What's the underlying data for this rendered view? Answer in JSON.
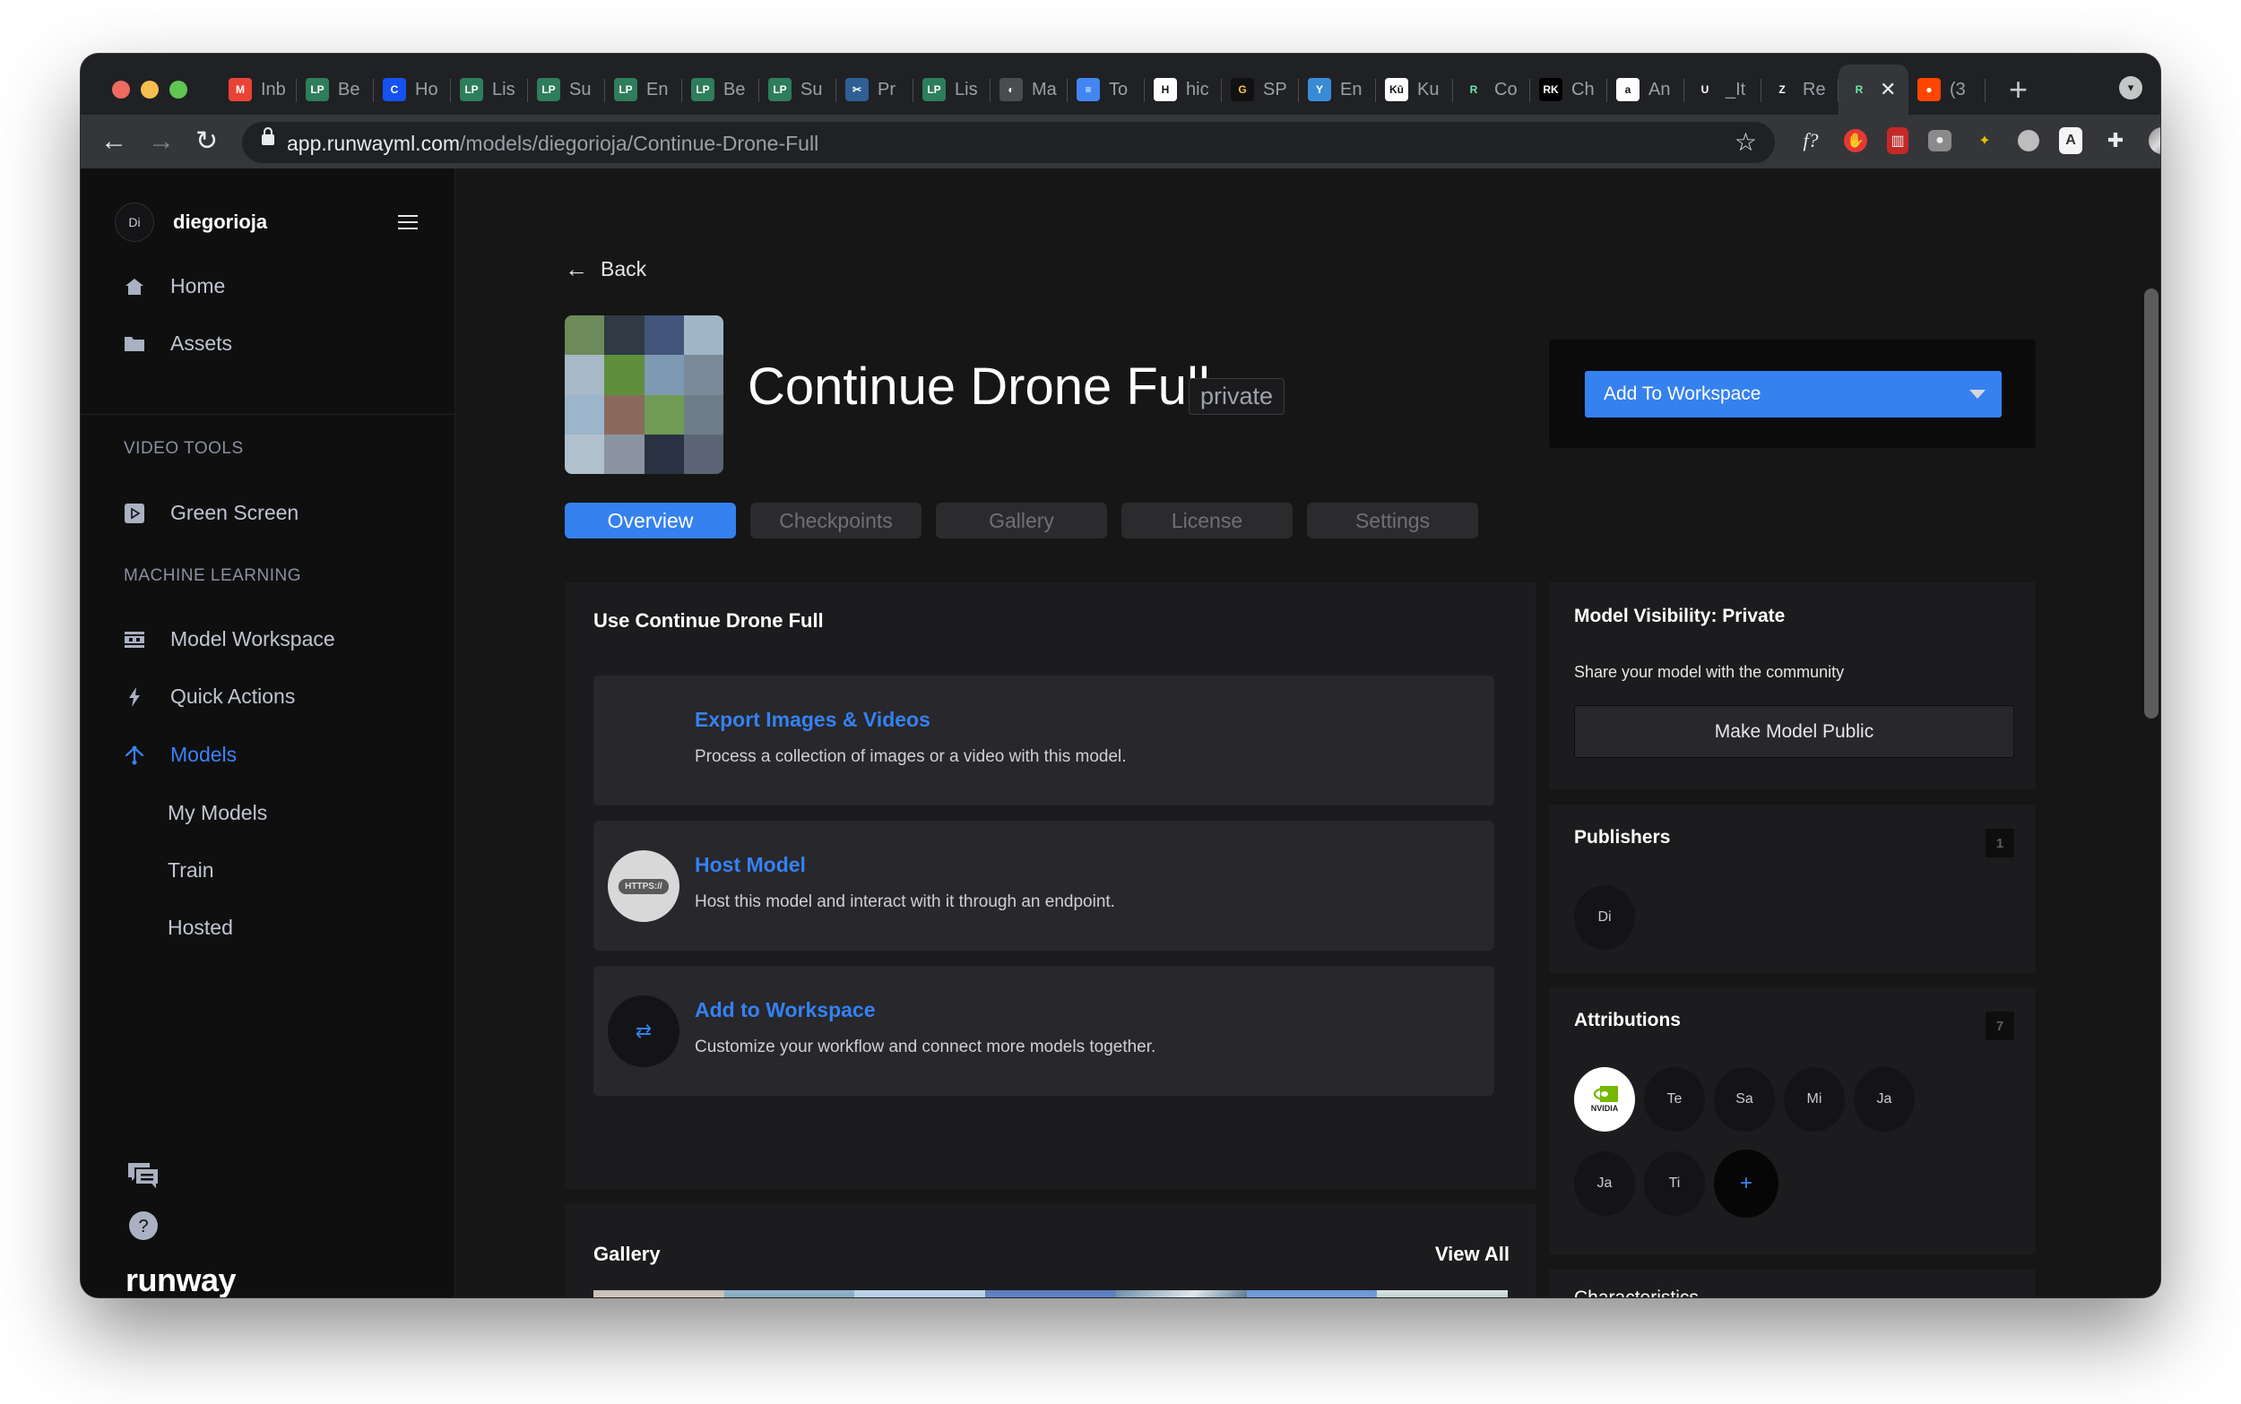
{
  "browser": {
    "tabs": [
      {
        "label": "Inb",
        "icon": "gmail-icon",
        "color": "#ea4335",
        "glyph": "M"
      },
      {
        "label": "Be",
        "icon": "lp-icon",
        "color": "#2e7d5b",
        "glyph": "LP"
      },
      {
        "label": "Ho",
        "icon": "coinbase-icon",
        "color": "#1652f0",
        "glyph": "C"
      },
      {
        "label": "Lis",
        "icon": "lp-icon",
        "color": "#2e7d5b",
        "glyph": "LP"
      },
      {
        "label": "Su",
        "icon": "lp-icon",
        "color": "#2e7d5b",
        "glyph": "LP"
      },
      {
        "label": "En",
        "icon": "lp-icon",
        "color": "#2e7d5b",
        "glyph": "LP"
      },
      {
        "label": "Be",
        "icon": "lp-icon",
        "color": "#2e7d5b",
        "glyph": "LP"
      },
      {
        "label": "Su",
        "icon": "lp-icon",
        "color": "#2e7d5b",
        "glyph": "LP"
      },
      {
        "label": "Pr",
        "icon": "tools-icon",
        "color": "#2f5f95",
        "glyph": "✂"
      },
      {
        "label": "Lis",
        "icon": "lp-icon",
        "color": "#2e7d5b",
        "glyph": "LP"
      },
      {
        "label": "Ma",
        "icon": "globe-icon",
        "color": "#4a4c50",
        "glyph": "◐"
      },
      {
        "label": "To",
        "icon": "docs-icon",
        "color": "#4285f4",
        "glyph": "≡"
      },
      {
        "label": "hic",
        "icon": "hen-icon",
        "color": "#ffffff",
        "glyph": "H"
      },
      {
        "label": "SP",
        "icon": "g-icon",
        "color": "#111111",
        "glyph": "G"
      },
      {
        "label": "En",
        "icon": "bird-icon",
        "color": "#3a8bd6",
        "glyph": "Y"
      },
      {
        "label": "Ku",
        "icon": "ku-icon",
        "color": "#ffffff",
        "glyph": "Kū"
      },
      {
        "label": "Co",
        "icon": "runway-icon",
        "color": "#202124",
        "glyph": "R"
      },
      {
        "label": "Ch",
        "icon": "rk-icon",
        "color": "#000000",
        "glyph": "RK"
      },
      {
        "label": "An",
        "icon": "amazon-icon",
        "color": "#ffffff",
        "glyph": "a"
      },
      {
        "label": "_It",
        "icon": "u-icon",
        "color": "#202124",
        "glyph": "U"
      },
      {
        "label": "Re",
        "icon": "zillow-icon",
        "color": "#202124",
        "glyph": "Z"
      },
      {
        "label": "",
        "icon": "runway-icon",
        "color": "#35363a",
        "glyph": "R",
        "active": true
      },
      {
        "label": "(3",
        "icon": "reddit-icon",
        "color": "#ff4500",
        "glyph": "●"
      }
    ],
    "close_glyph": "✕",
    "new_tab_glyph": "+",
    "url_host": "app.runwayml.com",
    "url_path": "/models/diegorioja/Continue-Drone-Full"
  },
  "sidebar": {
    "user_initials": "Di",
    "username": "diegorioja",
    "primary": [
      {
        "label": "Home",
        "icon": "home-icon"
      },
      {
        "label": "Assets",
        "icon": "folder-icon"
      }
    ],
    "video_tools_label": "VIDEO TOOLS",
    "video_tools": [
      {
        "label": "Green Screen",
        "icon": "play-icon"
      }
    ],
    "ml_label": "MACHINE LEARNING",
    "ml_items": [
      {
        "label": "Model Workspace",
        "icon": "workspace-icon"
      },
      {
        "label": "Quick Actions",
        "icon": "lightning-icon"
      },
      {
        "label": "Models",
        "icon": "models-icon",
        "active": true
      }
    ],
    "model_subitems": [
      "My Models",
      "Train",
      "Hosted"
    ],
    "logo": "runway"
  },
  "header": {
    "back_label": "Back",
    "model_title": "Continue Drone Full",
    "visibility_badge": "private",
    "add_to_workspace": "Add To Workspace",
    "tabs": [
      "Overview",
      "Checkpoints",
      "Gallery",
      "License",
      "Settings"
    ],
    "active_tab": "Overview"
  },
  "use_section": {
    "title": "Use Continue Drone Full",
    "actions": [
      {
        "name": "Export Images & Videos",
        "desc": "Process a collection of images or a video with this model.",
        "icon": "image-mosaic-icon"
      },
      {
        "name": "Host Model",
        "desc": "Host this model and interact with it through an endpoint.",
        "icon": "https-icon",
        "icon_text": "HTTPS://"
      },
      {
        "name": "Add to Workspace",
        "desc": "Customize your workflow and connect more models together.",
        "icon": "swap-arrows-icon",
        "icon_text": "⇄"
      }
    ]
  },
  "gallery": {
    "title": "Gallery",
    "view_all": "View All"
  },
  "visibility": {
    "title": "Model Visibility: Private",
    "share_text": "Share your model with the community",
    "button": "Make Model Public"
  },
  "publishers": {
    "title": "Publishers",
    "count": "1",
    "items": [
      "Di"
    ]
  },
  "attributions": {
    "title": "Attributions",
    "count": "7",
    "logo_label": "NVIDIA",
    "items": [
      "Te",
      "Sa",
      "Mi",
      "Ja",
      "Ja",
      "Ti"
    ],
    "more": "+"
  },
  "characteristics": {
    "title": "Characteristics"
  },
  "colors": {
    "accent": "#3581f0",
    "sidebar_bg": "#0f0f10",
    "panel_bg": "#1c1c1e",
    "card_bg": "#27272c"
  }
}
